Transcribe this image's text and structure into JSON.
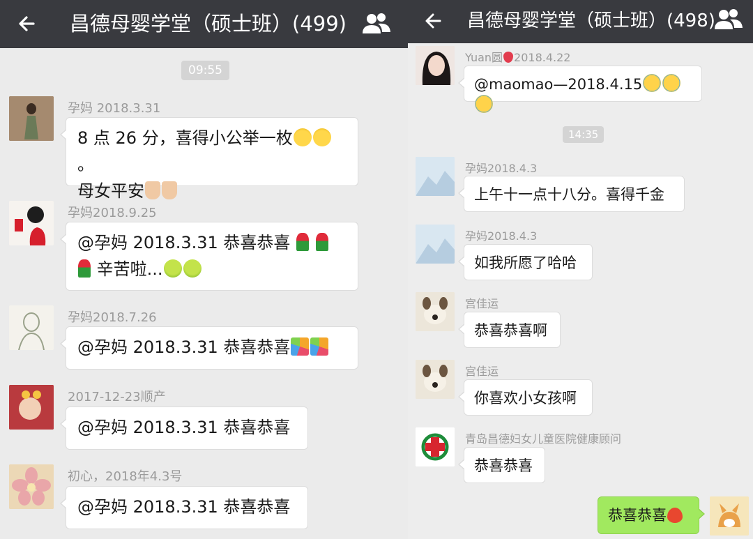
{
  "left": {
    "title": "昌德母婴学堂（硕士班）(499)",
    "time": "09:55",
    "messages": [
      {
        "nick": "孕妈 2018.3.31",
        "line1": "8 点 26 分，喜得小公举一枚",
        "line1_end": "。",
        "line2": "母女平安"
      },
      {
        "nick": "孕妈2018.9.25",
        "line1": "@孕妈 2018.3.31  恭喜恭喜",
        "line2": "辛苦啦..."
      },
      {
        "nick": "孕妈2018.7.26",
        "text": "@孕妈 2018.3.31  恭喜恭喜"
      },
      {
        "nick": "2017-12-23顺产",
        "text": "@孕妈 2018.3.31  恭喜恭喜"
      },
      {
        "nick": "初心，2018年4.3号",
        "text": "@孕妈 2018.3.31  恭喜恭喜"
      }
    ]
  },
  "right": {
    "title": "昌德母婴学堂（硕士班）(498)",
    "time": "14:35",
    "messages": [
      {
        "nick_pre": "Yuan圆",
        "nick_post": "2018.4.22",
        "text": "@maomao—2018.4.15"
      },
      {
        "nick": "孕妈2018.4.3",
        "text": "上午十一点十八分。喜得千金"
      },
      {
        "nick": "孕妈2018.4.3",
        "text": "如我所愿了哈哈"
      },
      {
        "nick": "宫佳运",
        "text": "恭喜恭喜啊"
      },
      {
        "nick": "宫佳运",
        "text": "你喜欢小女孩啊"
      },
      {
        "nick": "青岛昌德妇女儿童医院健康顾问",
        "text": "恭喜恭喜"
      }
    ],
    "my_message": "恭喜恭喜"
  },
  "icons": {
    "back": "back-arrow-icon",
    "group": "group-members-icon"
  }
}
